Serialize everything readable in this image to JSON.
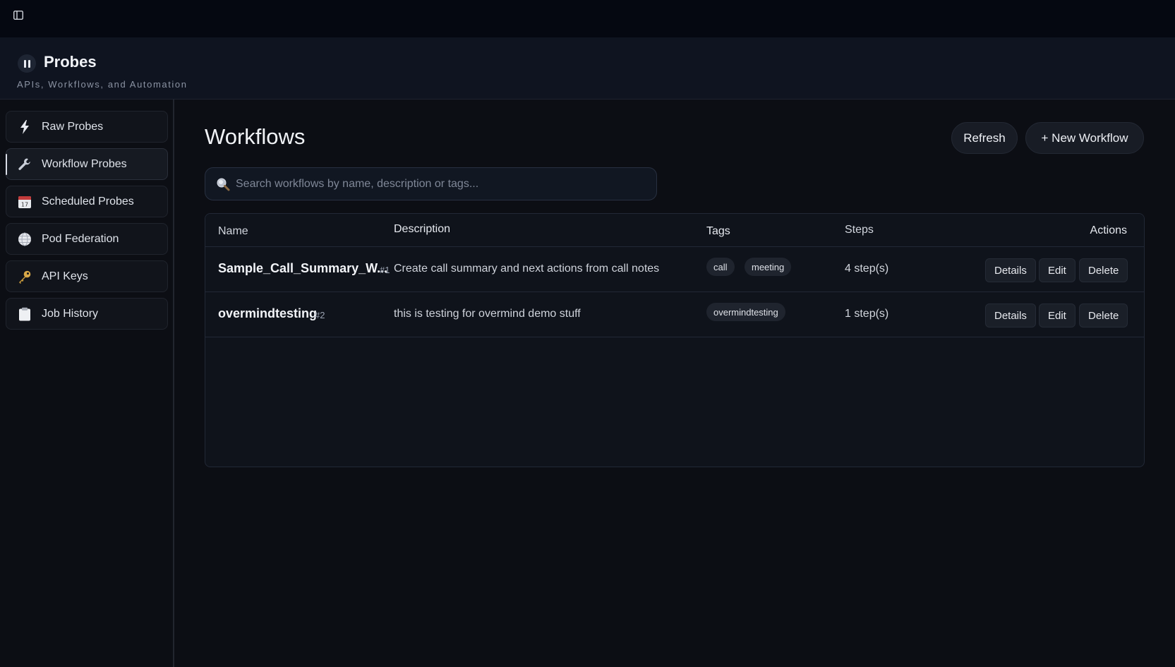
{
  "brand": {
    "title": "Probes",
    "subtitle": "APIs, Workflows, and Automation"
  },
  "sidebar": {
    "items": [
      {
        "label": "Raw Probes",
        "icon": "lightning-icon",
        "active": false
      },
      {
        "label": "Workflow Probes",
        "icon": "wrench-icon",
        "active": true
      },
      {
        "label": "Scheduled Probes",
        "icon": "calendar-icon",
        "active": false
      },
      {
        "label": "Pod Federation",
        "icon": "globe-icon",
        "active": false
      },
      {
        "label": "API Keys",
        "icon": "key-icon",
        "active": false
      },
      {
        "label": "Job History",
        "icon": "clipboard-icon",
        "active": false
      }
    ]
  },
  "main": {
    "title": "Workflows",
    "refresh_label": "Refresh",
    "new_workflow_label": "+ New Workflow",
    "search": {
      "placeholder": "Search workflows by name, description or tags...",
      "value": ""
    }
  },
  "table": {
    "columns": {
      "name": "Name",
      "description": "Description",
      "tags": "Tags",
      "steps": "Steps",
      "actions": "Actions"
    },
    "rows": [
      {
        "name": "Sample_Call_Summary_W...",
        "number": "#1",
        "description": "Create call summary and next actions from call notes",
        "tags": [
          "call",
          "meeting"
        ],
        "steps": "4 step(s)"
      },
      {
        "name": "overmindtesting",
        "number": "#2",
        "description": "this is testing for overmind demo stuff",
        "tags": [
          "overmindtesting"
        ],
        "steps": "1 step(s)"
      }
    ],
    "actions": {
      "details": "Details",
      "edit": "Edit",
      "delete": "Delete"
    }
  },
  "colors": {
    "background": "#0c0e14",
    "topbar": "#050811",
    "header": "#0f1420",
    "panel": "#0f131b"
  }
}
